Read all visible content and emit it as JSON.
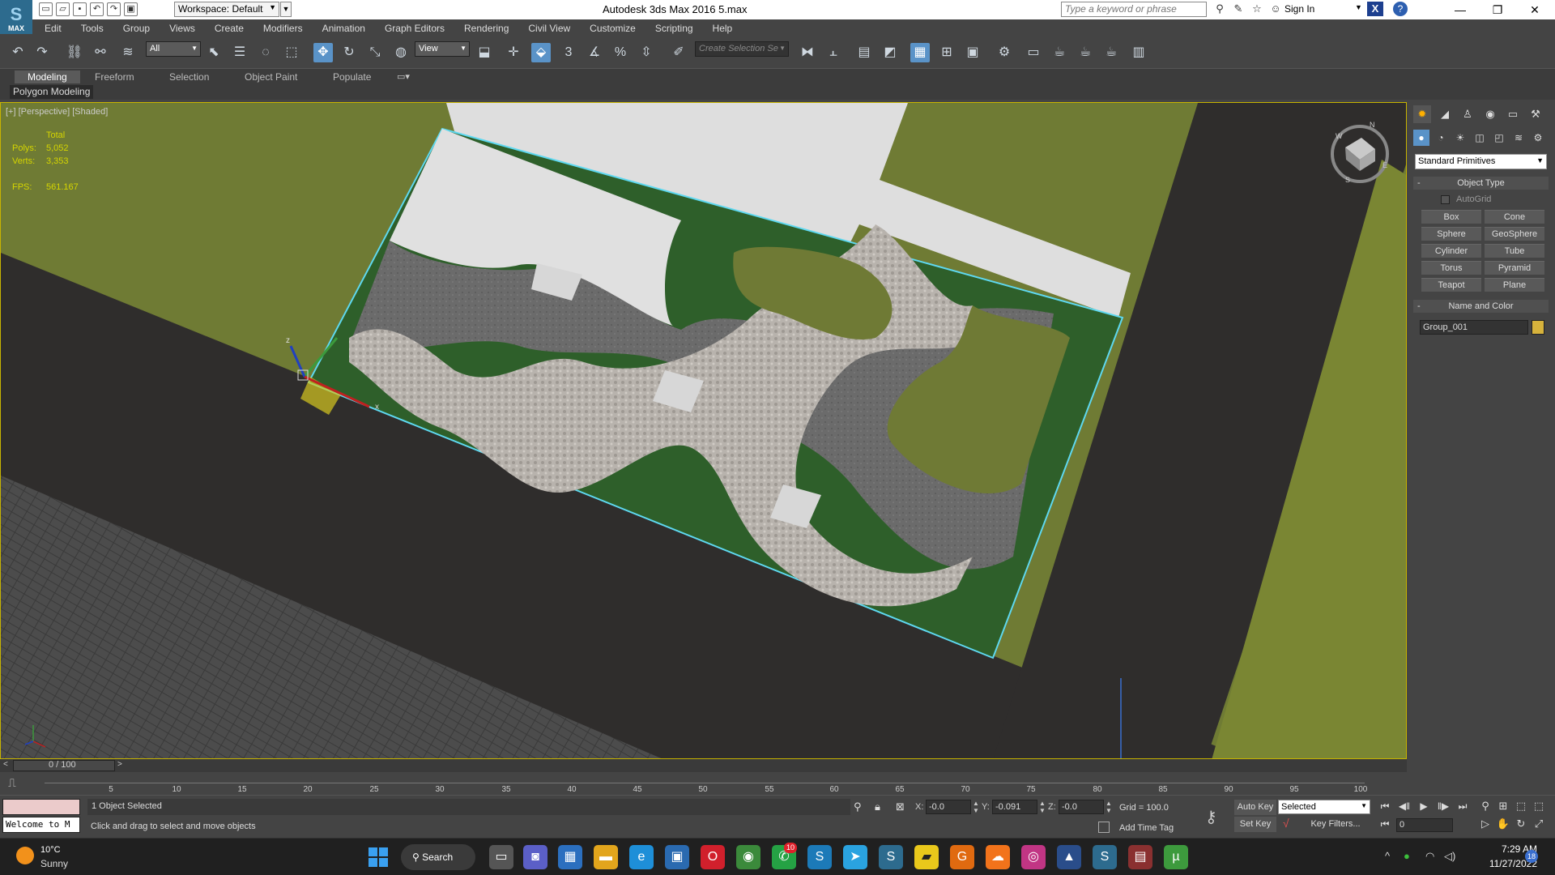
{
  "titlebar": {
    "logo_label": "MAX",
    "workspace": "Workspace: Default",
    "title": "Autodesk 3ds Max 2016     5.max",
    "search_placeholder": "Type a keyword or phrase",
    "sign_in": "Sign In"
  },
  "menu": [
    "Edit",
    "Tools",
    "Group",
    "Views",
    "Create",
    "Modifiers",
    "Animation",
    "Graph Editors",
    "Rendering",
    "Civil View",
    "Customize",
    "Scripting",
    "Help"
  ],
  "toolbar": {
    "filter": "All",
    "ref_coord": "View",
    "selection_set": "Create Selection Se",
    "snap_label": "3"
  },
  "ribbon": {
    "tabs": [
      "Modeling",
      "Freeform",
      "Selection",
      "Object Paint",
      "Populate"
    ],
    "panel": "Polygon Modeling"
  },
  "viewport": {
    "label": "[+] [Perspective] [Shaded]",
    "stats": {
      "total_label": "Total",
      "polys_label": "Polys:",
      "polys": "5,052",
      "verts_label": "Verts:",
      "verts": "3,353",
      "fps_label": "FPS:",
      "fps": "561.167"
    }
  },
  "command_panel": {
    "primitive_type": "Standard Primitives",
    "object_type_title": "Object Type",
    "autogrid": "AutoGrid",
    "primitives": [
      "Box",
      "Cone",
      "Sphere",
      "GeoSphere",
      "Cylinder",
      "Tube",
      "Torus",
      "Pyramid",
      "Teapot",
      "Plane"
    ],
    "name_color_title": "Name and Color",
    "object_name": "Group_001",
    "object_color": "#d6b23c"
  },
  "timeline": {
    "counter": "0 / 100",
    "ticks": [
      "5",
      "10",
      "15",
      "20",
      "25",
      "30",
      "35",
      "40",
      "45",
      "50",
      "55",
      "60",
      "65",
      "70",
      "75",
      "80",
      "85",
      "90",
      "95",
      "100"
    ]
  },
  "status": {
    "maxscript": "Welcome to M",
    "selected": "1 Object Selected",
    "prompt": "Click and drag to select and move objects",
    "x_label": "X:",
    "x": "-0.0",
    "y_label": "Y:",
    "y": "-0.091",
    "z_label": "Z:",
    "z": "-0.0",
    "grid": "Grid = 100.0",
    "add_time_tag": "Add Time Tag",
    "auto_key": "Auto Key",
    "set_key": "Set Key",
    "key_mode": "Selected",
    "key_filters": "Key Filters...",
    "frame": "0"
  },
  "taskbar": {
    "temperature": "10°C",
    "condition": "Sunny",
    "search": "Search",
    "whatsapp_badge": "10",
    "time": "7:29 AM",
    "date": "11/27/2022",
    "notifications": "18"
  }
}
